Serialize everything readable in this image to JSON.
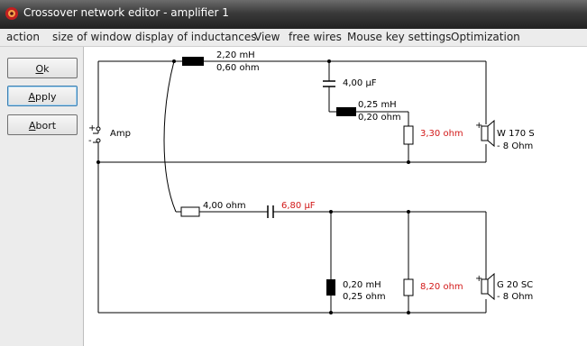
{
  "window": {
    "title": "Crossover network editor - amplifier 1"
  },
  "menu": {
    "items": [
      "action",
      "size of window",
      "display of inductances",
      "View",
      "free wires",
      "Mouse key settings",
      "Optimization"
    ]
  },
  "sidebar": {
    "ok_mnemonic": "O",
    "ok_rest": "k",
    "apply_mnemonic": "A",
    "apply_rest": "pply",
    "abort_mnemonic": "A",
    "abort_rest": "bort"
  },
  "circuit": {
    "amp_label": "Amp",
    "plus_sign": "+",
    "minus_sign": "-",
    "l1_inductance": "2,20 mH",
    "l1_resistance": "0,60 ohm",
    "c1_value": "4,00 µF",
    "l2_inductance": "0,25 mH",
    "l2_resistance": "0,20 ohm",
    "r1_value": "3,30 ohm",
    "speaker1_name": "W 170 S",
    "speaker1_impedance": "- 8 Ohm",
    "r2_value": "4,00 ohm",
    "c2_value": "6,80 µF",
    "l3_inductance": "0,20 mH",
    "l3_resistance": "0,25 ohm",
    "r3_value": "8,20 ohm",
    "speaker2_name": "G 20 SC",
    "speaker2_impedance": "- 8 Ohm"
  },
  "colors": {
    "titlebar": "#2e2e2e",
    "optimized_value": "#d21818",
    "panel": "#ececec"
  }
}
